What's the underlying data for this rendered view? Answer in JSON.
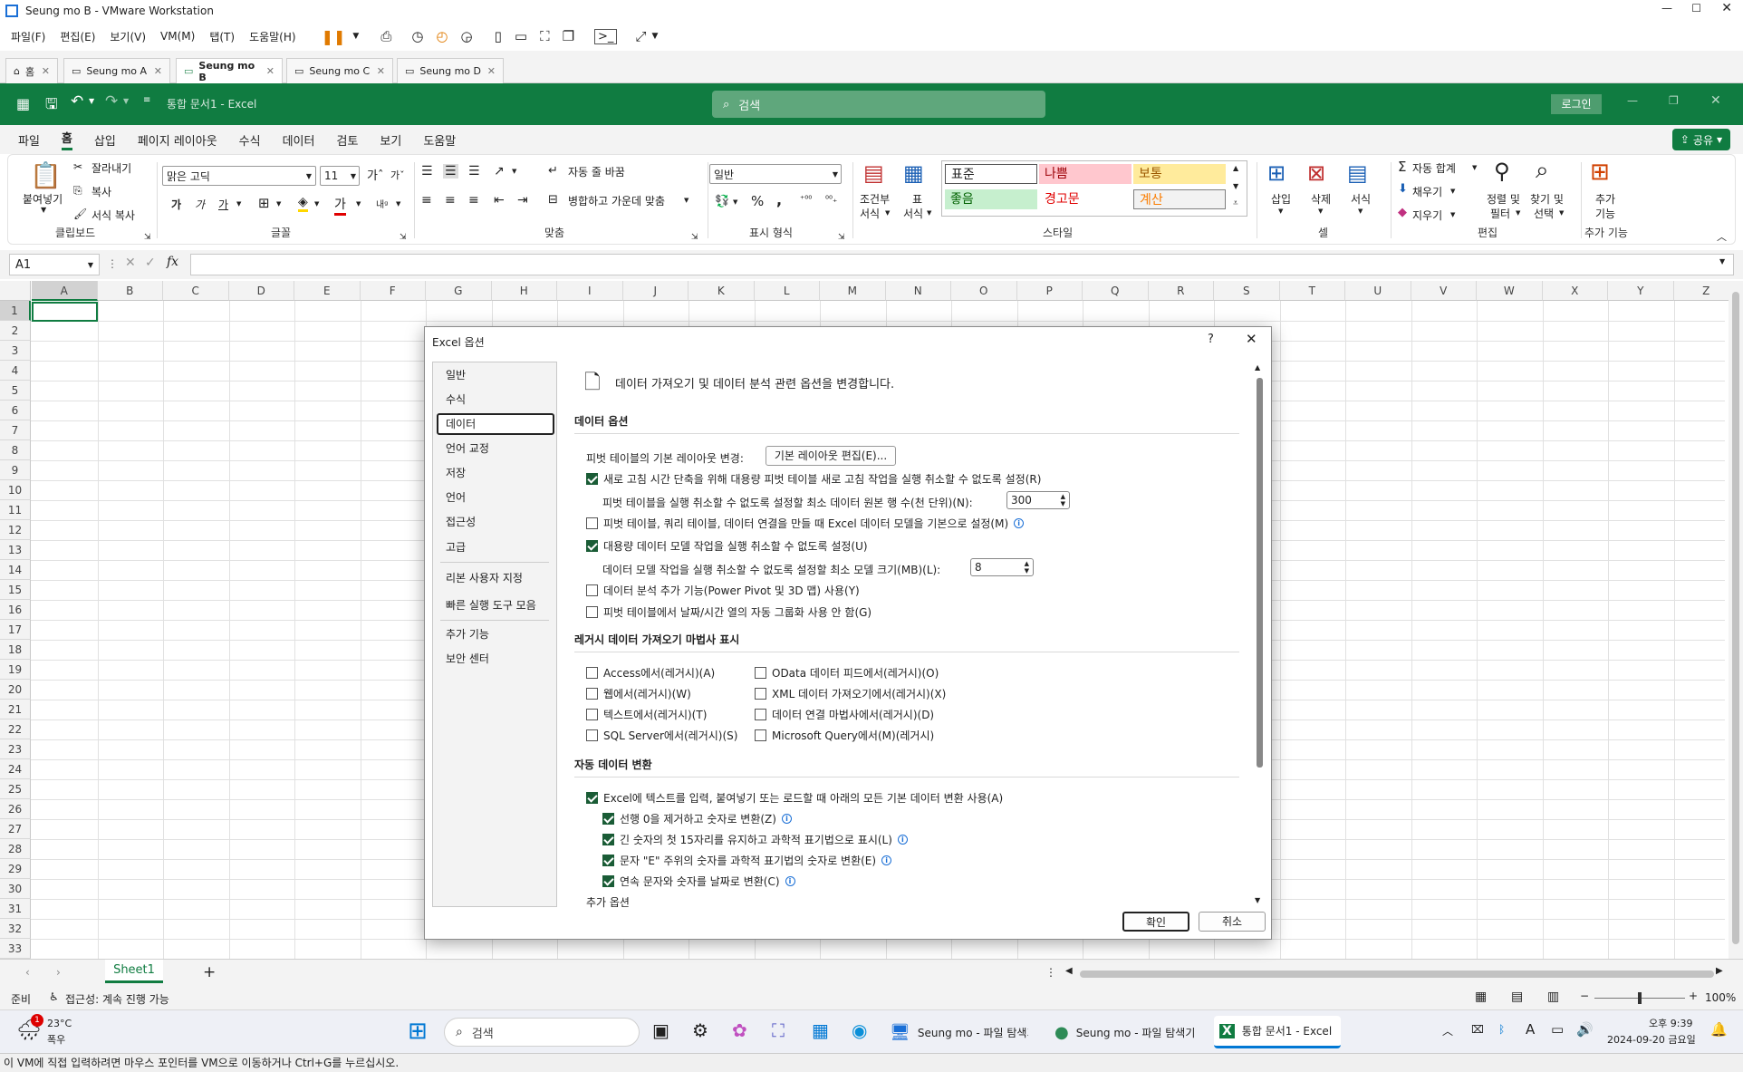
{
  "vm": {
    "title": "Seung mo B - VMware Workstation",
    "menu": [
      "파일(F)",
      "편집(E)",
      "보기(V)",
      "VM(M)",
      "탭(T)",
      "도움말(H)"
    ],
    "tabs": [
      "홈",
      "Seung mo A",
      "Seung mo B",
      "Seung mo C",
      "Seung mo D"
    ],
    "status_message": "이 VM에 직접 입력하려면 마우스 포인터를 VM으로 이동하거나 Ctrl+G를 누르십시오."
  },
  "excel": {
    "doc_title": "통합 문서1 - Excel",
    "search_placeholder": "검색",
    "login": "로그인",
    "menu": [
      "파일",
      "홈",
      "삽입",
      "페이지 레이아웃",
      "수식",
      "데이터",
      "검토",
      "보기",
      "도움말"
    ],
    "share": "공유",
    "ribbon": {
      "paste": "붙여넣기",
      "cut": "잘라내기",
      "copy": "복사",
      "format_painter": "서식 복사",
      "clipboard": "클립보드",
      "font_name": "맑은 고딕",
      "font_size": "11",
      "font_group": "글꼴",
      "wrap_text": "자동 줄 바꿈",
      "merge_center": "병합하고 가운데 맞춤",
      "align_group": "맞춤",
      "number_format": "일반",
      "number_group": "표시 형식",
      "cond_format_1": "조건부",
      "cond_format_2": "서식",
      "table_format_1": "표",
      "table_format_2": "서식",
      "styles": {
        "normal": "표준",
        "bad": "나쁨",
        "neutral": "보통",
        "good": "좋음",
        "warning": "경고문",
        "calc": "계산"
      },
      "styles_group": "스타일",
      "insert": "삽입",
      "delete": "삭제",
      "format": "서식",
      "cells_group": "셀",
      "autosum": "자동 합계",
      "fill": "채우기",
      "clear": "지우기",
      "sort_1": "정렬 및",
      "sort_2": "필터",
      "find_1": "찾기 및",
      "find_2": "선택",
      "edit_group": "편집",
      "addins_1": "추가",
      "addins_2": "기능",
      "addins_group": "추가 기능"
    },
    "name_box": "A1",
    "columns": [
      "A",
      "B",
      "C",
      "D",
      "E",
      "F",
      "G",
      "H",
      "I",
      "J",
      "K",
      "L",
      "M",
      "N",
      "O",
      "P",
      "Q",
      "R",
      "S",
      "T",
      "U",
      "V",
      "W",
      "X",
      "Y",
      "Z"
    ],
    "rows": [
      "1",
      "2",
      "3",
      "4",
      "5",
      "6",
      "7",
      "8",
      "9",
      "10",
      "11",
      "12",
      "13",
      "14",
      "15",
      "16",
      "17",
      "18",
      "19",
      "20",
      "21",
      "22",
      "23",
      "24",
      "25",
      "26",
      "27",
      "28",
      "29",
      "30",
      "31",
      "32",
      "33"
    ],
    "sheet_tab": "Sheet1",
    "status_ready": "준비",
    "status_accessibility": "접근성: 계속 진행 가능",
    "zoom": "100%"
  },
  "dialog": {
    "title": "Excel 옵션",
    "help": "?",
    "nav": [
      "일반",
      "수식",
      "데이터",
      "언어 교정",
      "저장",
      "언어",
      "접근성",
      "고급",
      "리본 사용자 지정",
      "빠른 실행 도구 모음",
      "추가 기능",
      "보안 센터"
    ],
    "selected_nav": "데이터",
    "header": "데이터 가져오기 및 데이터 분석 관련 옵션을 변경합니다.",
    "section_data": "데이터 옵션",
    "pivot_layout_label": "피벗 테이블의 기본 레이아웃 변경:",
    "pivot_layout_button": "기본 레이아웃 편집(E)...",
    "opt_undo_large_pivot": "새로 고침 시간 단축을 위해 대용량 피벗 테이블 새로 고침 작업을 실행 취소할 수 없도록 설정(R)",
    "opt_min_rows_label": "피벗 테이블을 실행 취소할 수 없도록 설정할 최소 데이터 원본 행 수(천 단위)(N):",
    "opt_min_rows_value": "300",
    "opt_data_model_default": "피벗 테이블, 쿼리 테이블, 데이터 연결을 만들 때 Excel 데이터 모델을 기본으로 설정(M)",
    "opt_undo_data_model": "대용량 데이터 모델 작업을 실행 취소할 수 없도록 설정(U)",
    "opt_min_model_label": "데이터 모델 작업을 실행 취소할 수 없도록 설정할 최소 모델 크기(MB)(L):",
    "opt_min_model_value": "8",
    "opt_analysis_addins": "데이터 분석 추가 기능(Power Pivot 및 3D 맵) 사용(Y)",
    "opt_no_auto_group": "피벗 테이블에서 날짜/시간 열의 자동 그룹화 사용 안 함(G)",
    "section_legacy": "레거시 데이터 가져오기 마법사 표시",
    "legacy": [
      "Access에서(레거시)(A)",
      "OData 데이터 피드에서(레거시)(O)",
      "웹에서(레거시)(W)",
      "XML 데이터 가져오기에서(레거시)(X)",
      "텍스트에서(레거시)(T)",
      "데이터 연결 마법사에서(레거시)(D)",
      "SQL Server에서(레거시)(S)",
      "Microsoft Query에서(M)(레거시)"
    ],
    "section_auto": "자동 데이터 변환",
    "auto_main": "Excel에 텍스트를 입력, 붙여넣기 또는 로드할 때 아래의 모든 기본 데이터 변환 사용(A)",
    "auto_sub": [
      "선행 0을 제거하고 숫자로 변환(Z)",
      "긴 숫자의 첫 15자리를 유지하고 과학적 표기법으로 표시(L)",
      "문자 \"E\" 주위의 숫자를 과학적 표기법의 숫자로 변환(E)",
      "연속 문자와 숫자를 날짜로 변환(C)"
    ],
    "more_options": "추가 옵션",
    "ok": "확인",
    "cancel": "취소"
  },
  "taskbar": {
    "weather_temp": "23°C",
    "weather_desc": "폭우",
    "weather_badge": "1",
    "search": "검색",
    "apps": [
      "Seung mo - 파일 탐색기",
      "Seung mo - 파일 탐색기",
      "통합 문서1 - Excel"
    ],
    "time": "오후 9:39",
    "date": "2024-09-20 금요일"
  },
  "colors": {
    "excel_green": "#107c41",
    "accent": "#1a5c36"
  }
}
